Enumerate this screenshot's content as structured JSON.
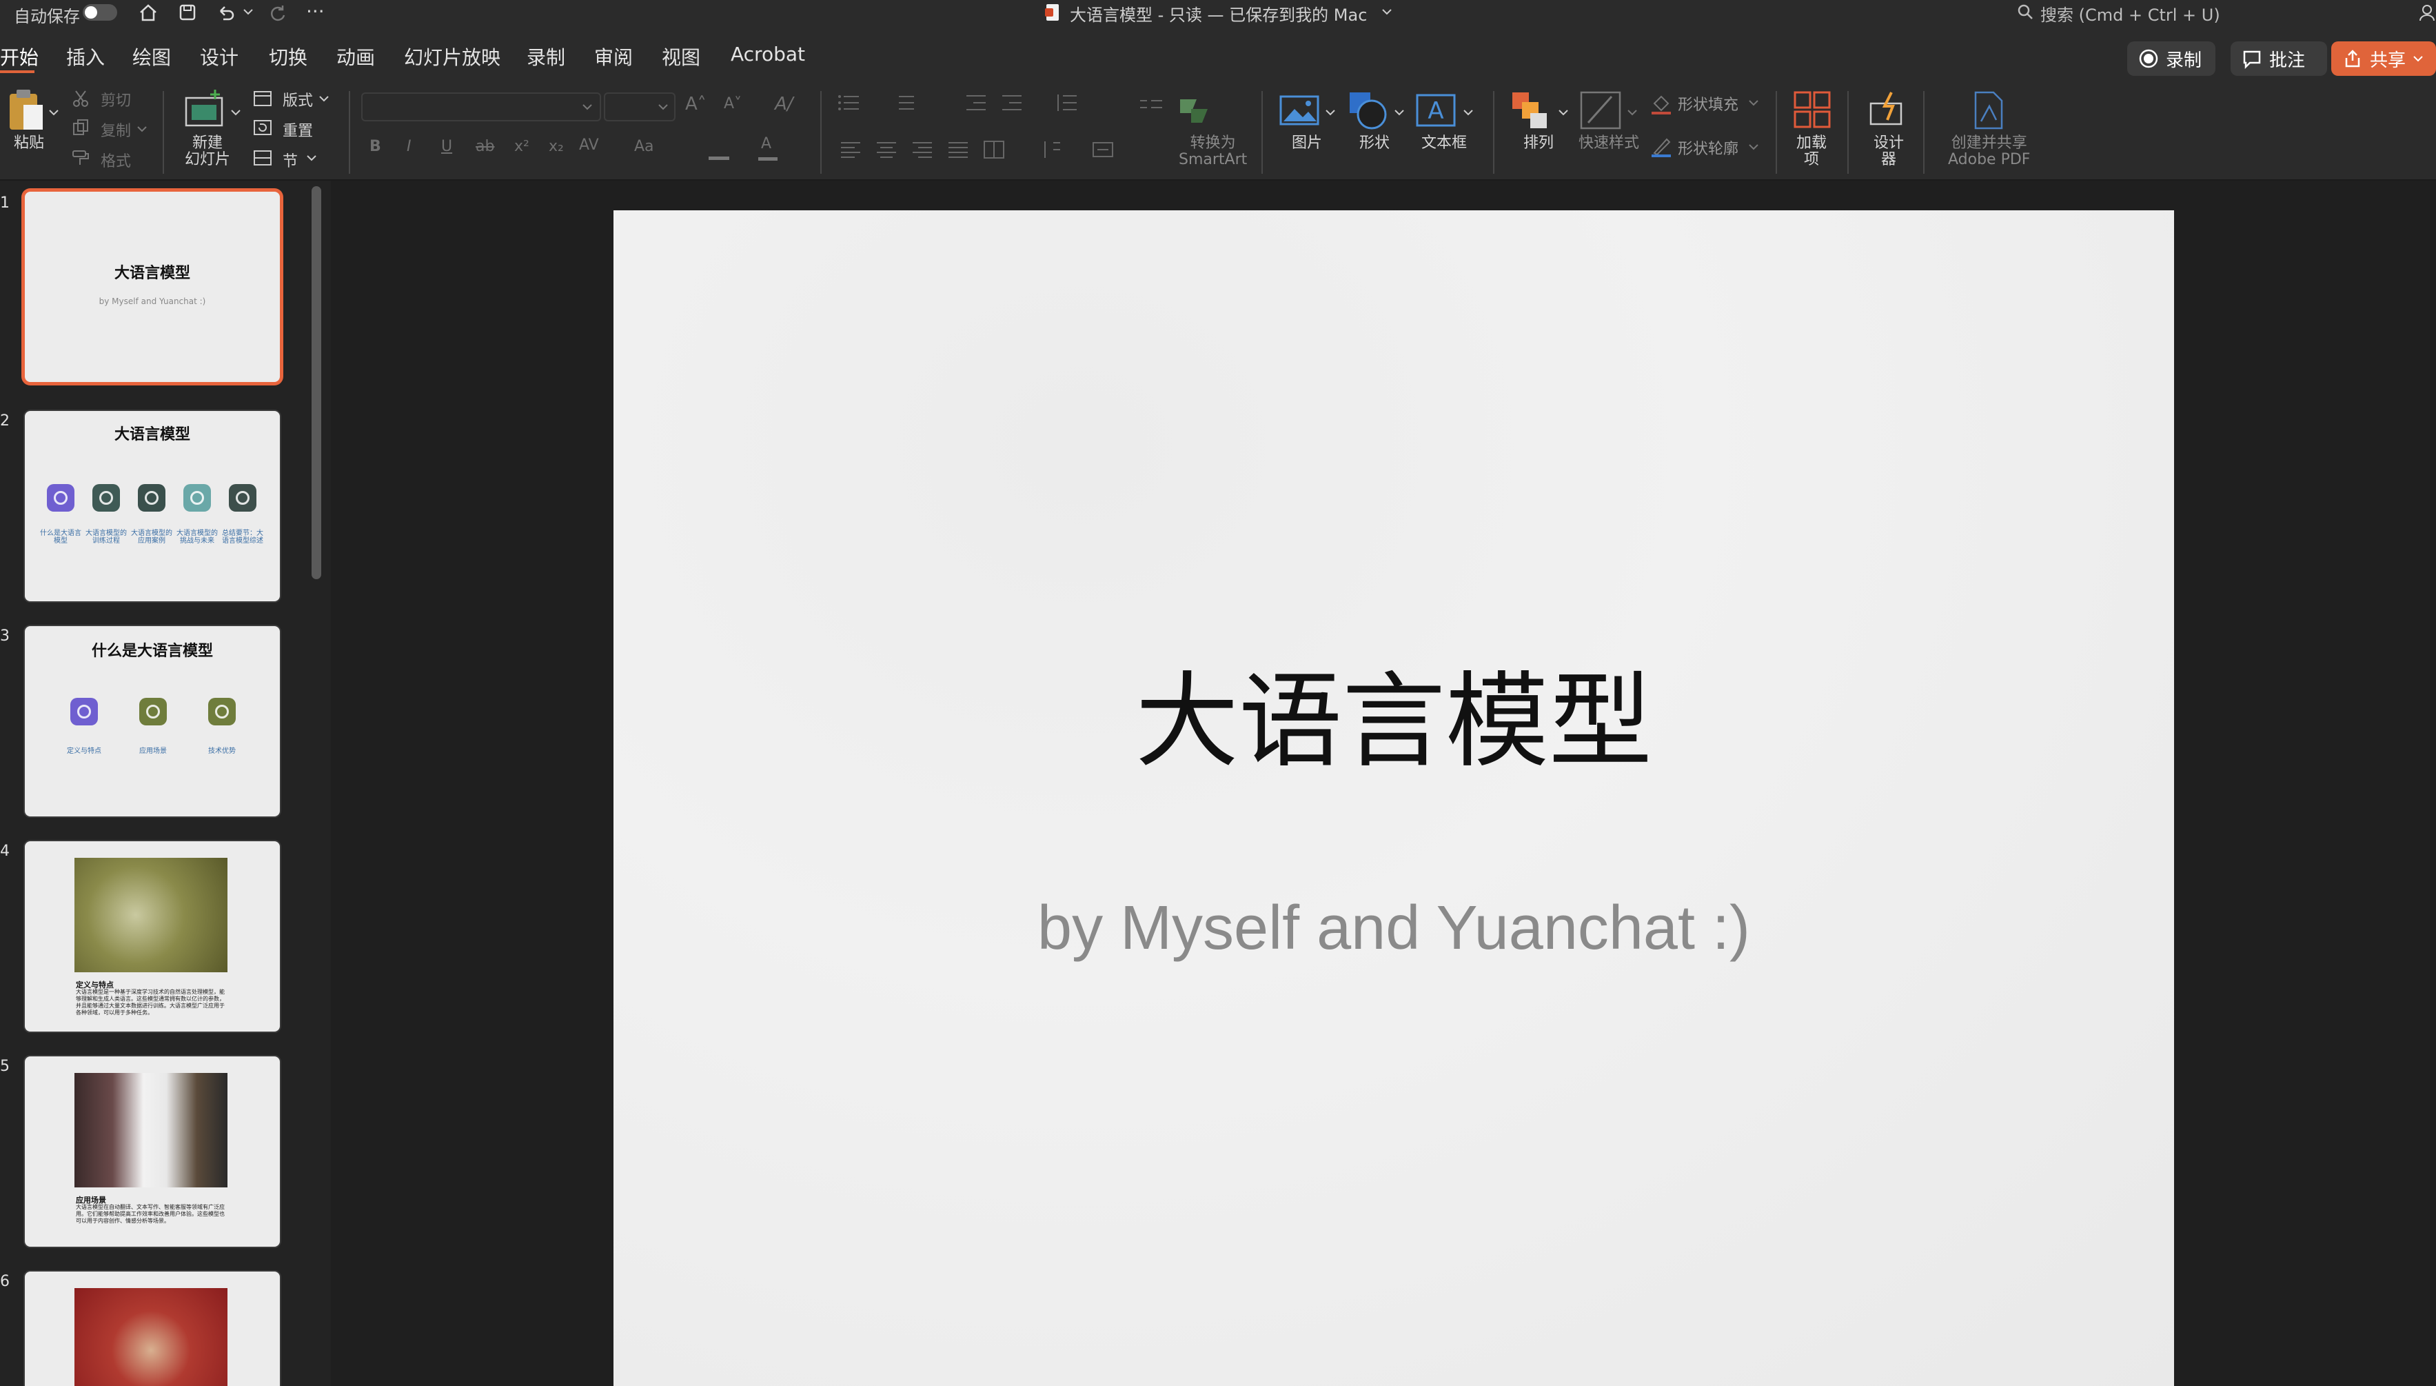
{
  "titlebar": {
    "autosave_label": "自动保存",
    "doc_title": "大语言模型  -  只读 — 已保存到我的 Mac",
    "search_placeholder": "搜索 (Cmd + Ctrl + U)"
  },
  "tabs": [
    "开始",
    "插入",
    "绘图",
    "设计",
    "切换",
    "动画",
    "幻灯片放映",
    "录制",
    "审阅",
    "视图",
    "Acrobat"
  ],
  "actions": {
    "record": "录制",
    "comment": "批注",
    "share": "共享"
  },
  "ribbon": {
    "paste": "粘贴",
    "cut": "剪切",
    "copy": "复制",
    "format": "格式",
    "new_slide": "新建\n幻灯片",
    "layout": "版式",
    "reset": "重置",
    "section": "节",
    "convert_smartart": "转换为\nSmartArt",
    "picture": "图片",
    "shapes": "形状",
    "textbox": "文本框",
    "arrange": "排列",
    "quick_styles": "快速样式",
    "shape_fill": "形状填充",
    "shape_outline": "形状轮廓",
    "addins": "加载\n项",
    "designer": "设计\n器",
    "adobe_pdf": "创建并共享\nAdobe PDF"
  },
  "slides": [
    {
      "num": "1",
      "title": "大语言模型",
      "subtitle": "by Myself and Yuanchat :)"
    },
    {
      "num": "2",
      "title": "大语言模型",
      "labels": [
        "什么是大语言模型",
        "大语言模型的训练过程",
        "大语言模型的应用案例",
        "大语言模型的挑战与未来",
        "总结要节：大语言模型综述"
      ]
    },
    {
      "num": "3",
      "title": "什么是大语言模型",
      "labels": [
        "定义与特点",
        "应用场景",
        "技术优势"
      ]
    },
    {
      "num": "4",
      "heading": "定义与特点",
      "body": "大语言模型是一种基于深度学习技术的自然语言处理模型，能够理解和生成人类语言。这些模型通常拥有数以亿计的参数，并且能够通过大量文本数据进行训练。大语言模型广泛应用于各种领域，可以用于多种任务。"
    },
    {
      "num": "5",
      "heading": "应用场景",
      "body": "大语言模型在自动翻译、文本写作、智能客服等领域有广泛应用。它们能够帮助提高工作效率和改善用户体验。这些模型也可以用于内容创作、情感分析等场景。"
    },
    {
      "num": "6"
    }
  ],
  "main_slide": {
    "title": "大语言模型",
    "subtitle": "by Myself and Yuanchat :)"
  },
  "colors": {
    "accent": "#e0643a",
    "selection": "#e8643c"
  }
}
